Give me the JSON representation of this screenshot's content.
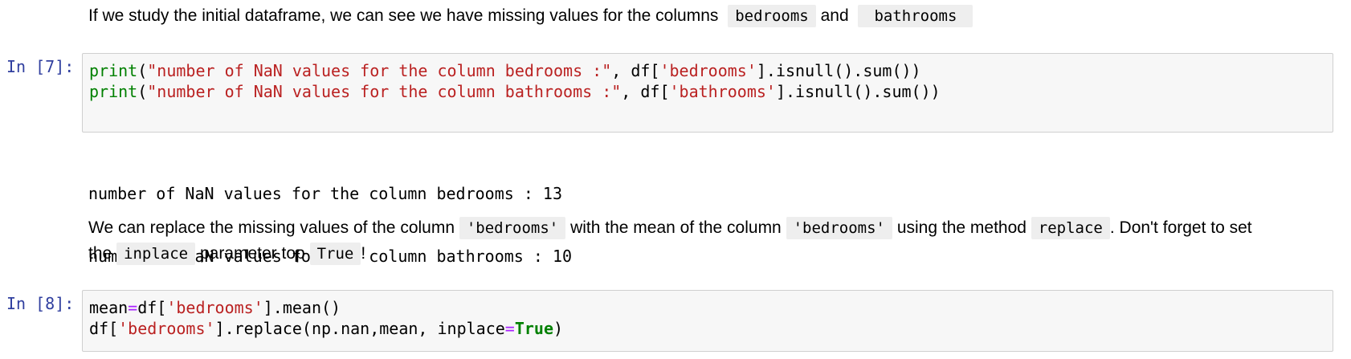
{
  "md1": {
    "text": "If we study the initial dataframe, we can see we have missing values for the columns",
    "code1": "bedrooms",
    "and": "and",
    "code2": "bathrooms"
  },
  "cell7": {
    "prompt": "In [7]:",
    "line1": {
      "fn": "print",
      "open": "(",
      "str1": "\"number of NaN values for the column bedrooms :\"",
      "mid": ", df[",
      "str2": "'bedrooms'",
      "tail": "].isnull().sum())"
    },
    "line2": {
      "fn": "print",
      "open": "(",
      "str1": "\"number of NaN values for the column bathrooms :\"",
      "mid": ", df[",
      "str2": "'bathrooms'",
      "tail": "].isnull().sum())"
    },
    "output": [
      "number of NaN values for the column bedrooms : 13",
      "number of NaN values for the column bathrooms : 10"
    ]
  },
  "md2": {
    "t1": "We can replace the missing values of the column",
    "c1": "'bedrooms'",
    "t2": "with the mean of the column",
    "c2": "'bedrooms'",
    "t3": "using the method",
    "c3": "replace",
    "t4": ". Don't forget to set",
    "t5": "the",
    "c4": "inplace",
    "t6": "parameter top",
    "c5": "True",
    "t7": "!"
  },
  "cell8": {
    "prompt": "In [8]:",
    "line1": {
      "a": "mean",
      "eq": "=",
      "b": "df[",
      "s": "'bedrooms'",
      "c": "].mean()"
    },
    "line2": {
      "a": "df[",
      "s": "'bedrooms'",
      "b": "].replace(np.nan,mean, inplace",
      "eq": "=",
      "t": "True",
      "c": ")"
    }
  }
}
